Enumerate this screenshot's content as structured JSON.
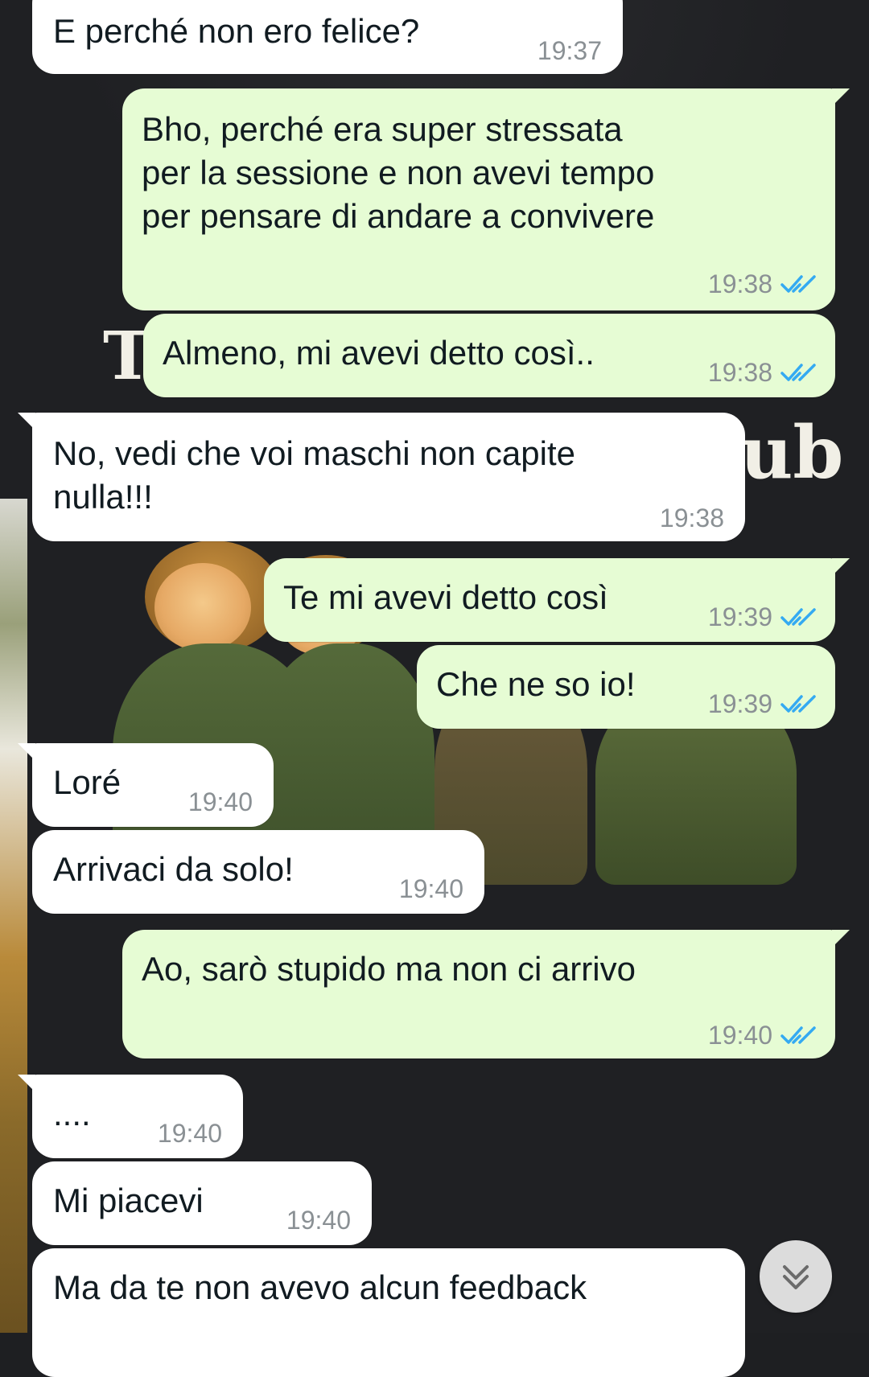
{
  "messages": [
    {
      "id": "m1",
      "direction": "incoming",
      "text": "E perché non ero felice?",
      "time": "19:37"
    },
    {
      "id": "m2",
      "direction": "outgoing",
      "text": "Bho, perché era super stressata\nper la sessione e non avevi tempo\nper pensare di andare a convivere",
      "time": "19:38",
      "status": "read"
    },
    {
      "id": "m3",
      "direction": "outgoing",
      "text": "Almeno, mi avevi detto così..",
      "time": "19:38",
      "status": "read"
    },
    {
      "id": "m4",
      "direction": "incoming",
      "text": "No, vedi che voi maschi non capite\nnulla!!!",
      "time": "19:38"
    },
    {
      "id": "m5",
      "direction": "outgoing",
      "text": "Te mi avevi detto così",
      "time": "19:39",
      "status": "read"
    },
    {
      "id": "m6",
      "direction": "outgoing",
      "text": "Che ne so io!",
      "time": "19:39",
      "status": "read"
    },
    {
      "id": "m7",
      "direction": "incoming",
      "text": "Loré",
      "time": "19:40"
    },
    {
      "id": "m8",
      "direction": "incoming",
      "text": "Arrivaci da solo!",
      "time": "19:40"
    },
    {
      "id": "m9",
      "direction": "outgoing",
      "text": "Ao, sarò stupido ma non ci arrivo",
      "time": "19:40",
      "status": "read"
    },
    {
      "id": "m10",
      "direction": "incoming",
      "text": "....",
      "time": "19:40"
    },
    {
      "id": "m11",
      "direction": "incoming",
      "text": "Mi piacevi",
      "time": "19:40"
    },
    {
      "id": "m12",
      "direction": "incoming",
      "text": "Ma da te non avevo alcun feedback",
      "time": ""
    }
  ],
  "wallpaper": {
    "letters_left": "T",
    "letters_right": "ub"
  },
  "colors": {
    "incoming_bubble": "#ffffff",
    "outgoing_bubble": "#e6fcd4",
    "read_ticks": "#34aaf2",
    "timestamp": "#8a9094"
  },
  "icons": {
    "read_receipt": "double-check-icon",
    "scroll_down": "double-chevron-down-icon"
  }
}
